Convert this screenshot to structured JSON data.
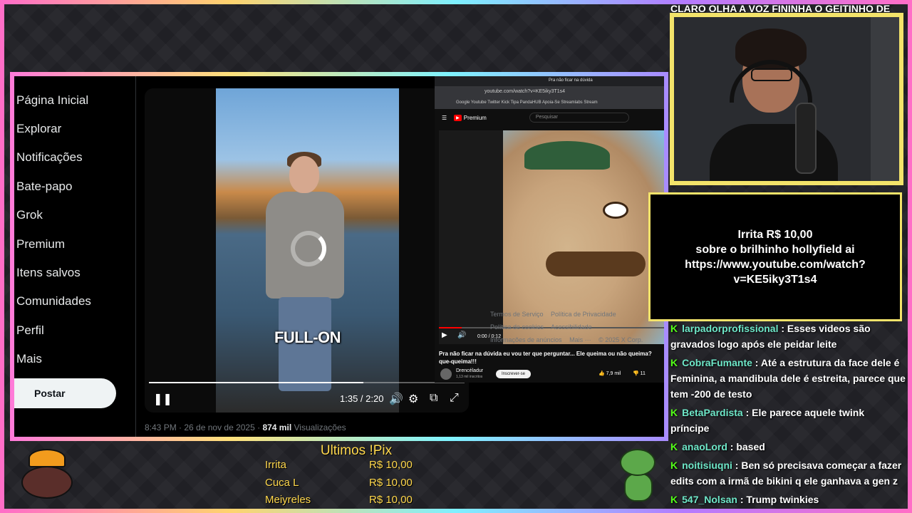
{
  "overlay": {
    "cam_title": "CLARO OLHA A VOZ FININHA O GEITINHO DE",
    "alert": {
      "line1": "Irrita R$ 10,00",
      "line2": "sobre o brilhinho hollyfield ai",
      "line3": "https://www.youtube.com/watch?",
      "line4": "v=KE5iky3T1s4"
    }
  },
  "x_nav": {
    "items": [
      "Página Inicial",
      "Explorar",
      "Notificações",
      "Bate-papo",
      "Grok",
      "Premium",
      "Itens salvos",
      "Comunidades",
      "Perfil",
      "Mais"
    ],
    "post_button": "Postar"
  },
  "tweet": {
    "caption": "FULL-ON",
    "time_readout": "1:35 / 2:20",
    "progress": 0.68,
    "meta_time": "8:43 PM · 26 de nov de 2025 · ",
    "meta_views": "874 mil",
    "meta_views_label": " Visualizações"
  },
  "youtube": {
    "tab": "Pra não ficar na dúvida",
    "url": "youtube.com/watch?v=KE5iky3T1s4",
    "bookmarks": "Google  Youtube  Twitter  Kick  Tipa  PandaHUB  Apoia-Se  Streamlabs  Stream",
    "logo": "Premium",
    "search_placeholder": "Pesquisar",
    "time": "0:00 / 0:12",
    "title": "Pra não ficar na dúvida eu vou ter que perguntar... Ele queima ou não queima? que-queima!!!",
    "channel": "Drencéladur",
    "subs": "1,13 mil inscritos",
    "subscribe": "Inscrever-se",
    "likes": "7,9 mil",
    "dislikes": "11"
  },
  "x_footer": [
    "Termos de Serviço",
    "Política de Privacidade",
    "Política de cookies",
    "Acessibilidade",
    "Informações de anúncios",
    "Mais ···",
    "© 2025 X Corp."
  ],
  "chat": [
    {
      "user": "larpadorprofissional",
      "text": " : Esses videos são gravados logo após ele peidar leite"
    },
    {
      "user": "CobraFumante",
      "text": " : Até a estrutura da face dele é Feminina, a mandibula dele é estreita, parece que tem -200 de testo"
    },
    {
      "user": "BetaPardista",
      "text": " : Ele parece aquele twink príncipe"
    },
    {
      "user": "anaoLord",
      "text": " : based"
    },
    {
      "user": "noitisiuqni",
      "text": " : Ben só precisava começar a fazer edits com a irmã de bikini q ele ganhava a gen z"
    },
    {
      "user": "547_Nolsan",
      "text": " : Trump twinkies"
    }
  ],
  "chat_icon": "K",
  "pix": {
    "title": "Ultimos !Pix",
    "rows": [
      {
        "name": "Irrita",
        "amount": "R$ 10,00"
      },
      {
        "name": "Cuca L",
        "amount": "R$ 10,00"
      },
      {
        "name": "Meiyreles",
        "amount": "R$ 10,00"
      }
    ]
  }
}
